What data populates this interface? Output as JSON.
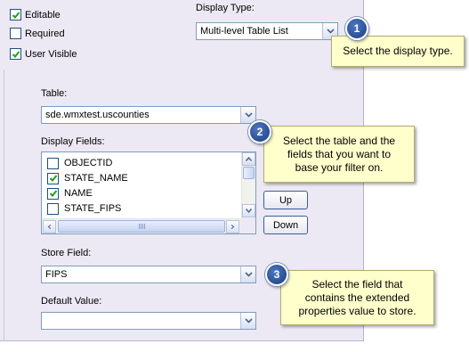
{
  "options": {
    "editable": {
      "label": "Editable",
      "checked": true
    },
    "required": {
      "label": "Required",
      "checked": false
    },
    "user_visible": {
      "label": "User Visible",
      "checked": true
    }
  },
  "display_type": {
    "label": "Display Type:",
    "value": "Multi-level Table List"
  },
  "table": {
    "label": "Table:",
    "value": "sde.wmxtest.uscounties"
  },
  "display_fields": {
    "label": "Display Fields:",
    "items": [
      {
        "name": "OBJECTID",
        "checked": false
      },
      {
        "name": "STATE_NAME",
        "checked": true
      },
      {
        "name": "NAME",
        "checked": true
      },
      {
        "name": "STATE_FIPS",
        "checked": false
      }
    ]
  },
  "buttons": {
    "up": "Up",
    "down": "Down"
  },
  "store_field": {
    "label": "Store Field:",
    "value": "FIPS"
  },
  "default_value": {
    "label": "Default Value:",
    "value": ""
  },
  "callouts": [
    {
      "number": "1",
      "text": "Select the display type."
    },
    {
      "number": "2",
      "text": "Select the table and the fields that you want to base your filter on."
    },
    {
      "number": "3",
      "text": "Select the field that contains the extended properties value to store."
    }
  ],
  "colors": {
    "panel": "#ECE9F4",
    "callout_bg": "#FFFFCC",
    "badge": "#1a3c80",
    "check": "#21a121"
  }
}
